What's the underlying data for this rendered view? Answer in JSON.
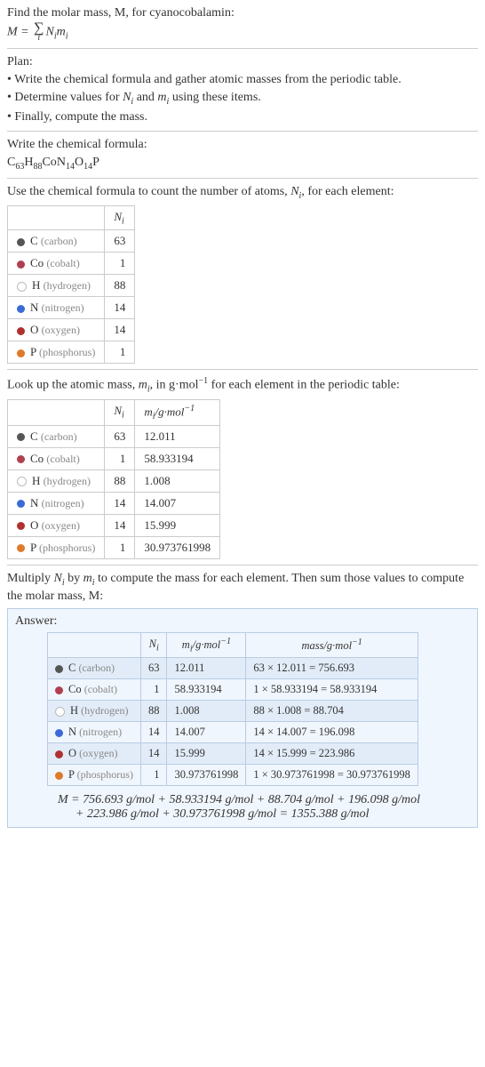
{
  "intro1": "Find the molar mass, M, for cyanocobalamin:",
  "formula_label_M": "M = ",
  "plan_title": "Plan:",
  "plan_1": "• Write the chemical formula and gather atomic masses from the periodic table.",
  "plan_2a": "• Determine values for ",
  "plan_2b": " and ",
  "plan_2c": " using these items.",
  "plan_3": "• Finally, compute the mass.",
  "step1": "Write the chemical formula:",
  "chem": {
    "c": "C",
    "c_n": "63",
    "h": "H",
    "h_n": "88",
    "co": "Co",
    "n": "N",
    "n_n": "14",
    "o": "O",
    "o_n": "14",
    "p": "P"
  },
  "step2a": "Use the chemical formula to count the number of atoms, ",
  "step2b": ", for each element:",
  "elements": [
    {
      "sym": "C",
      "name": "(carbon)",
      "color": "#555",
      "N": "63",
      "m": "12.011",
      "mass": "63 × 12.011 = 756.693"
    },
    {
      "sym": "Co",
      "name": "(cobalt)",
      "color": "#b04050",
      "N": "1",
      "m": "58.933194",
      "mass": "1 × 58.933194 = 58.933194"
    },
    {
      "sym": "H",
      "name": "(hydrogen)",
      "color": "#fff",
      "N": "88",
      "m": "1.008",
      "mass": "88 × 1.008 = 88.704"
    },
    {
      "sym": "N",
      "name": "(nitrogen)",
      "color": "#3b6bd6",
      "N": "14",
      "m": "14.007",
      "mass": "14 × 14.007 = 196.098"
    },
    {
      "sym": "O",
      "name": "(oxygen)",
      "color": "#b03030",
      "N": "14",
      "m": "15.999",
      "mass": "14 × 15.999 = 223.986"
    },
    {
      "sym": "P",
      "name": "(phosphorus)",
      "color": "#de7a2a",
      "N": "1",
      "m": "30.973761998",
      "mass": "1 × 30.973761998 = 30.973761998"
    }
  ],
  "tbl1_h1": "N",
  "step3a": "Look up the atomic mass, ",
  "step3b": ", in g·mol",
  "step3c": " for each element in the periodic table:",
  "tbl2_h2": "/g·mol",
  "step4a": "Multiply ",
  "step4b": " by ",
  "step4c": " to compute the mass for each element. Then sum those values to compute the molar mass, M:",
  "answer": "Answer:",
  "ans_h3": "mass/g·mol",
  "final1": "M = 756.693 g/mol + 58.933194 g/mol + 88.704 g/mol + 196.098 g/mol",
  "final2": "+ 223.986 g/mol + 30.973761998 g/mol = 1355.388 g/mol"
}
